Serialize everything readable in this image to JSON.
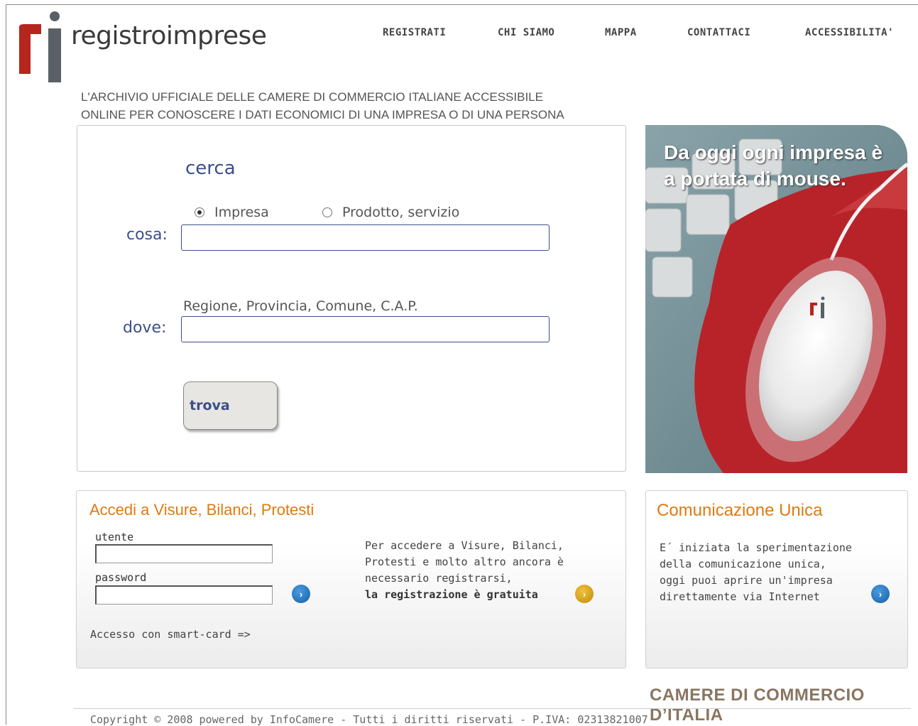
{
  "logo": {
    "text": "registroimprese"
  },
  "nav": [
    {
      "label": "REGISTRATI"
    },
    {
      "label": "CHI SIAMO"
    },
    {
      "label": "MAPPA"
    },
    {
      "label": "CONTATTACI"
    },
    {
      "label": "ACCESSIBILITA'"
    }
  ],
  "tagline": {
    "line1": "L'ARCHIVIO UFFICIALE DELLE CAMERE DI COMMERCIO ITALIANE ACCESSIBILE",
    "line2": "ONLINE PER CONOSCERE I DATI ECONOMICI DI UNA IMPRESA O DI UNA PERSONA"
  },
  "search": {
    "title": "cerca",
    "radio_impresa": "Impresa",
    "radio_prodotto": "Prodotto, servizio",
    "selected": "Impresa",
    "cosa_label": "cosa:",
    "cosa_value": "",
    "dove_hint": "Regione, Provincia, Comune, C.A.P.",
    "dove_label": "dove:",
    "dove_value": "",
    "button": "trova"
  },
  "promo": {
    "line1": "Da oggi ogni impresa è",
    "line2": "a portata di mouse."
  },
  "access_box": {
    "title": "Accedi a Visure, Bilanci, Protesti",
    "user_label": "utente",
    "password_label": "password",
    "info_line1": "Per accedere a Visure, Bilanci,",
    "info_line2": "Protesti e molto altro ancora è",
    "info_line3": "necessario registrarsi,",
    "info_bold": "la registrazione è gratuita",
    "smart_card": "Accesso con smart-card =>"
  },
  "comunicazione_box": {
    "title": "Comunicazione Unica",
    "line1": "E´ iniziata la sperimentazione",
    "line2": "della comunicazione unica,",
    "line3": "oggi puoi aprire un'impresa",
    "line4": "direttamente via Internet"
  },
  "footer": {
    "camere": "CAMERE DI COMMERCIO D’ITALIA",
    "copyright": "Copyright © 2008 powered by InfoCamere - Tutti i diritti riservati - P.IVA: 02313821007"
  },
  "colors": {
    "brand_red": "#b5261e",
    "brand_grey": "#5a6066",
    "heading_blue": "#3c4e8c",
    "accent_orange": "#e07a10"
  },
  "icons": {
    "go_button": "chevron-right-icon"
  }
}
